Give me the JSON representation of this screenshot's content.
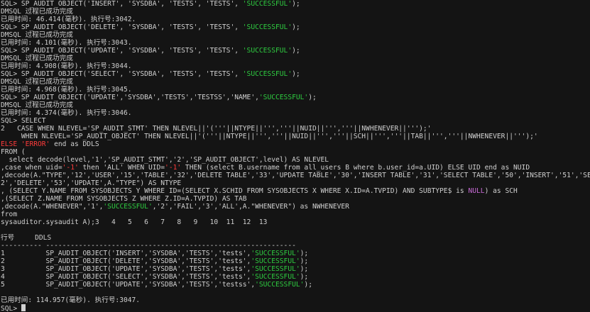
{
  "colors": {
    "background": "#141414",
    "text": "#d0d0d0",
    "string_literal": "#2ecc40",
    "keyword_null": "#c86bd6",
    "else_keyword": "#ff3b3b"
  },
  "terminal": {
    "lines": [
      [
        {
          "t": "SQL> SP_AUDIT_OBJECT('INSERT', 'SYSDBA', 'TESTS', 'TESTS', "
        },
        {
          "t": "'SUCCESSFUL'",
          "c": "green"
        },
        {
          "t": ");"
        }
      ],
      [
        {
          "t": "DMSQL 过程已成功完成"
        }
      ],
      [
        {
          "t": "已用时间: 46.414(毫秒). 执行号:3042."
        }
      ],
      [
        {
          "t": "SQL> SP_AUDIT_OBJECT('DELETE', 'SYSDBA', 'TESTS', 'TESTS', "
        },
        {
          "t": "'SUCCESSFUL'",
          "c": "green"
        },
        {
          "t": ");"
        }
      ],
      [
        {
          "t": "DMSQL 过程已成功完成"
        }
      ],
      [
        {
          "t": "已用时间: 4.101(毫秒). 执行号:3043."
        }
      ],
      [
        {
          "t": "SQL> SP_AUDIT_OBJECT('UPDATE', 'SYSDBA', 'TESTS', 'TESTS', "
        },
        {
          "t": "'SUCCESSFUL'",
          "c": "green"
        },
        {
          "t": ");"
        }
      ],
      [
        {
          "t": "DMSQL 过程已成功完成"
        }
      ],
      [
        {
          "t": "已用时间: 4.908(毫秒). 执行号:3044."
        }
      ],
      [
        {
          "t": "SQL> SP_AUDIT_OBJECT('SELECT', 'SYSDBA', 'TESTS', 'TESTS', "
        },
        {
          "t": "'SUCCESSFUL'",
          "c": "green"
        },
        {
          "t": ");"
        }
      ],
      [
        {
          "t": "DMSQL 过程已成功完成"
        }
      ],
      [
        {
          "t": "已用时间: 4.968(毫秒). 执行号:3045."
        }
      ],
      [
        {
          "t": "SQL> SP_AUDIT_OBJECT('UPDATE','SYSDBA','TESTS','TESTSS','NAME',"
        },
        {
          "t": "'SUCCESSFUL'",
          "c": "green"
        },
        {
          "t": ");"
        }
      ],
      [
        {
          "t": "DMSQL 过程已成功完成"
        }
      ],
      [
        {
          "t": "已用时间: 4.374(毫秒). 执行号:3046."
        }
      ],
      [
        {
          "t": "SQL> SELECT"
        }
      ],
      [
        {
          "t": "2   CASE WHEN NLEVEL='SP_AUDIT_STMT' THEN NLEVEL||'('''||NTYPE||''','''||NUID||''','''||NWHENEVER||''');'"
        }
      ],
      [
        {
          "t": "     WHEN NLEVEL='SP_AUDIT_OBJECT' THEN NLEVEL||'('''||NTYPE||''','''||NUID||''','''||SCH||''','''||TAB||''','''||NWHENEVER||''');'"
        }
      ],
      [
        {
          "t": "ELSE ",
          "c": "red"
        },
        {
          "t": "'ERROR'",
          "c": "red"
        },
        {
          "t": " end as DDLS"
        }
      ],
      [
        {
          "t": "FROM ("
        }
      ],
      [
        {
          "t": "  select decode(level,'1','SP_AUDIT_STMT','2','SP_AUDIT_OBJECT',level) AS NLEVEL"
        }
      ],
      [
        {
          "t": ",case when uid="
        },
        {
          "t": "'-1'",
          "c": "red"
        },
        {
          "t": " then 'ALL' WHEN UID="
        },
        {
          "t": "'-1'",
          "c": "red"
        },
        {
          "t": " THEN (select B.username from all_users B where b.user_id=a.UID) ELSE UID end as NUID"
        }
      ],
      [
        {
          "t": ",decode(A.\"TYPE\",'12','USER','15','TABLE','32','DELETE TABLE','33','UPDATE TABLE','30','INSERT TABLE','31','SELECT TABLE','50','INSERT','51','SELECT','5"
        }
      ],
      [
        {
          "t": "2','DELETE','53','UPDATE',A.\"TYPE\") AS NTYPE"
        }
      ],
      [
        {
          "t": ", (SELECT Y.NAME FROM SYSOBJECTS Y WHERE ID=(SELECT X.SCHID FROM SYSOBJECTS X WHERE X.ID=A.TVPID) AND SUBTYPE$ is "
        },
        {
          "t": "NULL",
          "c": "purple"
        },
        {
          "t": ") as SCH"
        }
      ],
      [
        {
          "t": ",(SELECT Z.NAME FROM SYSOBJECTS Z WHERE Z.ID=A.TVPID) AS TAB"
        }
      ],
      [
        {
          "t": ",decode(A.\"WHENEVER\",'1',"
        },
        {
          "t": "'SUCCESSFUL'",
          "c": "green"
        },
        {
          "t": ",'2','FAIL','3','ALL',A.\"WHENEVER\") as NWHENEVER"
        }
      ],
      [
        {
          "t": "from"
        }
      ],
      [
        {
          "t": "sysauditor.sysaudit A);3   4   5   6   7   8   9   10  11  12  13"
        }
      ],
      [
        {
          "t": ""
        }
      ],
      [
        {
          "t": "行号     DDLS"
        }
      ],
      [
        {
          "t": "---------- -------------------------------------------------------------"
        }
      ],
      [
        {
          "t": "1          SP_AUDIT_OBJECT('INSERT','SYSDBA','TESTS','tests',"
        },
        {
          "t": "'SUCCESSFUL'",
          "c": "green"
        },
        {
          "t": ");"
        }
      ],
      [
        {
          "t": "2          SP_AUDIT_OBJECT('DELETE','SYSDBA','TESTS','tests',"
        },
        {
          "t": "'SUCCESSFUL'",
          "c": "green"
        },
        {
          "t": ");"
        }
      ],
      [
        {
          "t": "3          SP_AUDIT_OBJECT('UPDATE','SYSDBA','TESTS','tests',"
        },
        {
          "t": "'SUCCESSFUL'",
          "c": "green"
        },
        {
          "t": ");"
        }
      ],
      [
        {
          "t": "4          SP_AUDIT_OBJECT('SELECT','SYSDBA','TESTS','tests',"
        },
        {
          "t": "'SUCCESSFUL'",
          "c": "green"
        },
        {
          "t": ");"
        }
      ],
      [
        {
          "t": "5          SP_AUDIT_OBJECT('UPDATE','SYSDBA','TESTS','testss',"
        },
        {
          "t": "'SUCCESSFUL'",
          "c": "green"
        },
        {
          "t": ");"
        }
      ],
      [
        {
          "t": ""
        }
      ],
      [
        {
          "t": "已用时间: 114.957(毫秒). 执行号:3047."
        }
      ],
      [
        {
          "t": "SQL> "
        }
      ]
    ]
  }
}
